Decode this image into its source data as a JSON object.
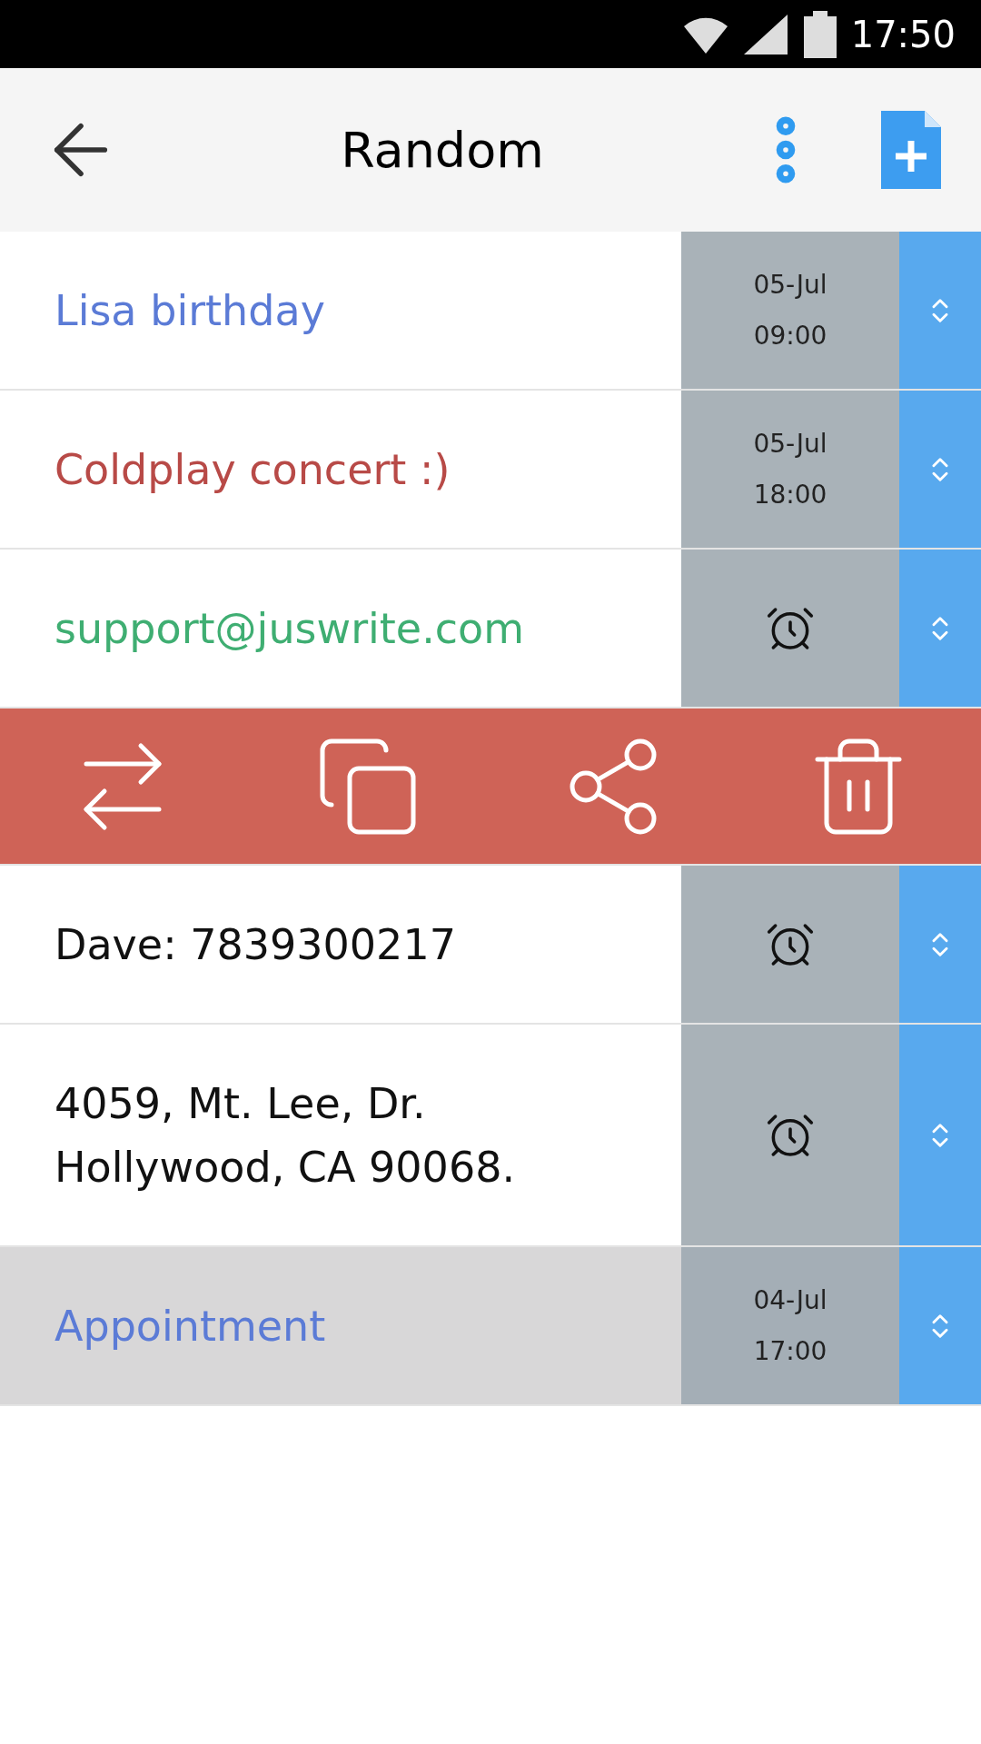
{
  "status_bar": {
    "time": "17:50"
  },
  "header": {
    "title": "Random"
  },
  "notes": [
    {
      "lines": [
        "Lisa birthday"
      ],
      "color": "#5b7bd6",
      "kind": "date",
      "date": "05-Jul",
      "time": "09:00",
      "selected": false
    },
    {
      "lines": [
        "Coldplay concert :)"
      ],
      "color": "#b84a47",
      "kind": "date",
      "date": "05-Jul",
      "time": "18:00",
      "selected": false
    },
    {
      "lines": [
        "support@juswrite.com"
      ],
      "color": "#3fae72",
      "kind": "alarm",
      "selected": false
    },
    {
      "kind": "actions"
    },
    {
      "lines": [
        "Dave: 7839300217"
      ],
      "color": "#111111",
      "kind": "alarm",
      "selected": false
    },
    {
      "lines": [
        "4059, Mt. Lee, Dr.",
        "Hollywood, CA 90068."
      ],
      "color": "#111111",
      "kind": "alarm",
      "selected": false
    },
    {
      "lines": [
        "Appointment"
      ],
      "color": "#5b7bd6",
      "kind": "date",
      "date": "04-Jul",
      "time": "17:00",
      "selected": true
    }
  ]
}
